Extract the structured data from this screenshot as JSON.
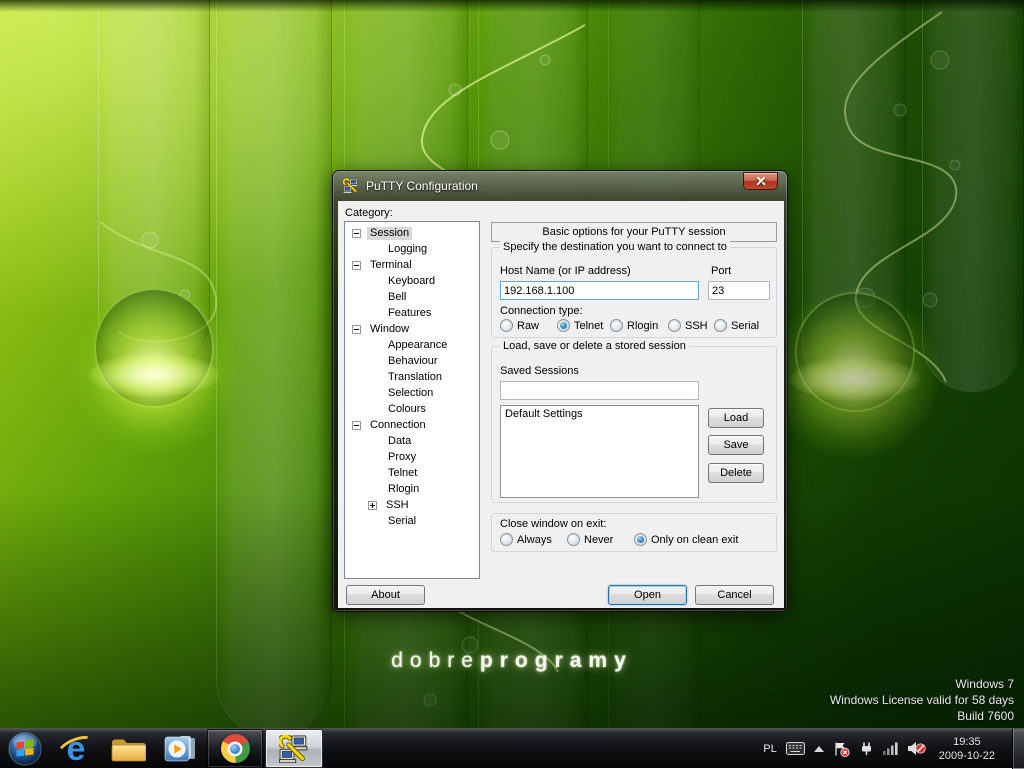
{
  "wallpaper": {
    "brand": {
      "light": "dobre",
      "bold": "programy"
    },
    "watermark": [
      "Windows 7",
      "Windows License valid for 58 days",
      "Build 7600"
    ]
  },
  "dialog": {
    "title": "PuTTY Configuration",
    "category_label": "Category:",
    "tree": [
      "Session",
      "Logging",
      "Terminal",
      "Keyboard",
      "Bell",
      "Features",
      "Window",
      "Appearance",
      "Behaviour",
      "Translation",
      "Selection",
      "Colours",
      "Connection",
      "Data",
      "Proxy",
      "Telnet",
      "Rlogin",
      "SSH",
      "Serial"
    ],
    "tree_selected": "Session",
    "panel": {
      "header": "Basic options for your PuTTY session",
      "destination": {
        "legend": "Specify the destination you want to connect to",
        "host_label": "Host Name (or IP address)",
        "host_value": "192.168.1.100",
        "port_label": "Port",
        "port_value": "23",
        "type_label": "Connection type:",
        "types": [
          "Raw",
          "Telnet",
          "Rlogin",
          "SSH",
          "Serial"
        ],
        "selected_type": "Telnet"
      },
      "session": {
        "legend": "Load, save or delete a stored session",
        "label": "Saved Sessions",
        "input_value": "",
        "items": [
          "Default Settings"
        ],
        "load": "Load",
        "save": "Save",
        "delete": "Delete"
      },
      "close": {
        "label": "Close window on exit:",
        "options": [
          "Always",
          "Never",
          "Only on clean exit"
        ],
        "selected": "Only on clean exit"
      },
      "buttons": {
        "about": "About",
        "open": "Open",
        "cancel": "Cancel"
      }
    }
  },
  "taskbar": {
    "items": [
      {
        "name": "start",
        "state": "normal"
      },
      {
        "name": "internet-explorer",
        "state": "pinned"
      },
      {
        "name": "windows-explorer",
        "state": "pinned"
      },
      {
        "name": "windows-media-player",
        "state": "pinned"
      },
      {
        "name": "google-chrome",
        "state": "running"
      },
      {
        "name": "putty",
        "state": "active"
      }
    ],
    "tray": {
      "lang": "PL",
      "icons": [
        "keyboard",
        "show-hidden-icons",
        "action-center-alert",
        "power",
        "network-signal",
        "volume-muted"
      ],
      "time": "19:35",
      "date": "2009-10-22"
    }
  }
}
